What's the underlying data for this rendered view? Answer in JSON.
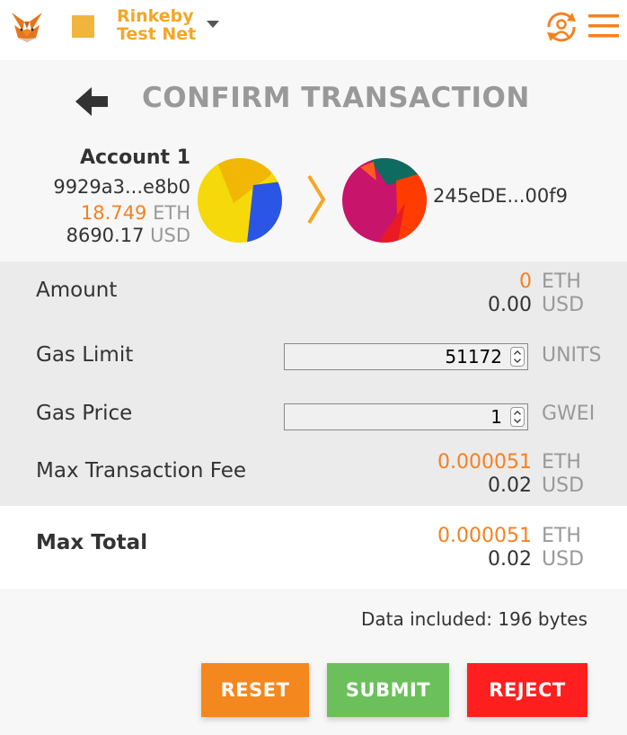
{
  "colors": {
    "accent": "#f5811f",
    "network": "#f1b53d",
    "reset": "#f5871f",
    "submit": "#6bc05b",
    "reject": "#ff1f1f"
  },
  "topbar": {
    "network_name_line1": "Rinkeby",
    "network_name_line2": "Test Net",
    "icons": [
      "metamask-fox-icon",
      "network-square-icon",
      "caret-down-icon",
      "account-sync-icon",
      "hamburger-menu-icon"
    ]
  },
  "header": {
    "title": "CONFIRM TRANSACTION"
  },
  "from_account": {
    "name": "Account 1",
    "address": "9929a3...e8b0",
    "balance_eth": "18.749",
    "eth_unit": "ETH",
    "balance_usd": "8690.17",
    "usd_unit": "USD"
  },
  "to_account": {
    "address": "245eDE...00f9"
  },
  "details": {
    "amount": {
      "label": "Amount",
      "eth": "0",
      "eth_unit": "ETH",
      "usd": "0.00",
      "usd_unit": "USD"
    },
    "gas_limit": {
      "label": "Gas Limit",
      "value": "51172",
      "unit": "UNITS"
    },
    "gas_price": {
      "label": "Gas Price",
      "value": "1",
      "unit": "GWEI"
    },
    "max_fee": {
      "label": "Max Transaction Fee",
      "eth": "0.000051",
      "eth_unit": "ETH",
      "usd": "0.02",
      "usd_unit": "USD"
    }
  },
  "total": {
    "label": "Max Total",
    "eth": "0.000051",
    "eth_unit": "ETH",
    "usd": "0.02",
    "usd_unit": "USD"
  },
  "data_included": "Data included: 196 bytes",
  "buttons": {
    "reset": "RESET",
    "submit": "SUBMIT",
    "reject": "REJECT"
  }
}
